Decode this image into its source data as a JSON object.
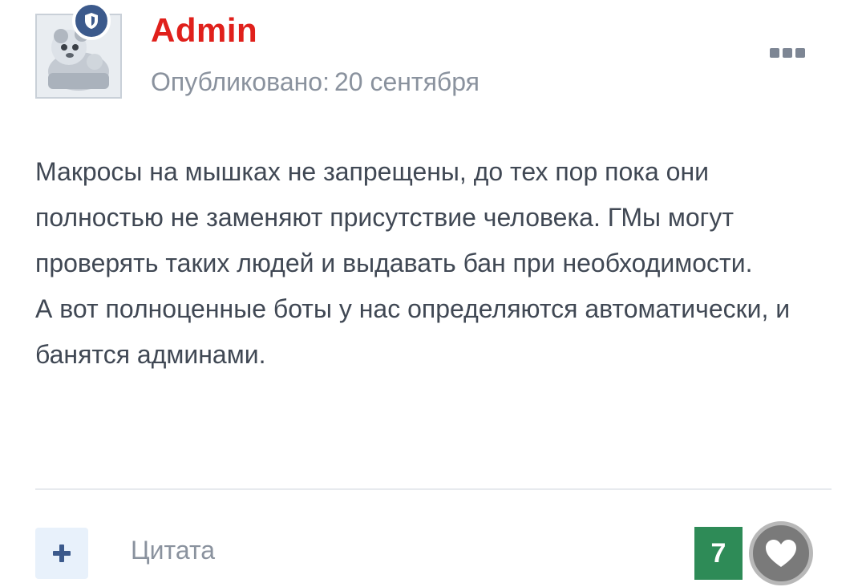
{
  "post": {
    "author": "Admin",
    "date_label": "Опубликовано:",
    "date_value": "20 сентября",
    "body": [
      "Макросы на мышках не запрещены, до тех пор пока они полностью не заменяют присутствие человека. ГМы могут проверять таких людей и выдавать бан при необходимости.",
      "А вот полноценные боты у нас определяются автоматически, и банятся админами."
    ]
  },
  "actions": {
    "quote_label": "Цитата",
    "reaction_count": "7"
  },
  "icons": {
    "badge": "shield-icon",
    "menu": "more-options-icon",
    "plus": "plus-icon",
    "like": "heart-icon"
  },
  "colors": {
    "author": "#e0201b",
    "badge": "#3c5a8c",
    "reaction": "#2e8b57",
    "muted_text": "#8a929e"
  }
}
